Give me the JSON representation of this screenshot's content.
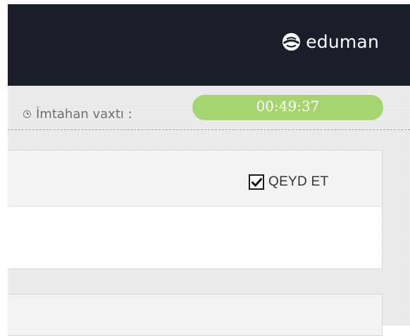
{
  "header": {
    "brand_icon": "eduman-logo-icon",
    "brand_name": "eduman",
    "background_color": "#1a1e2b"
  },
  "exam": {
    "time_icon": "clock-icon",
    "time_label": "İmtahan vaxtı :",
    "time_remaining": "00:49:37",
    "timer_color": "#a6d471"
  },
  "question": {
    "mark_label": "QEYD ET",
    "mark_checked": true
  }
}
